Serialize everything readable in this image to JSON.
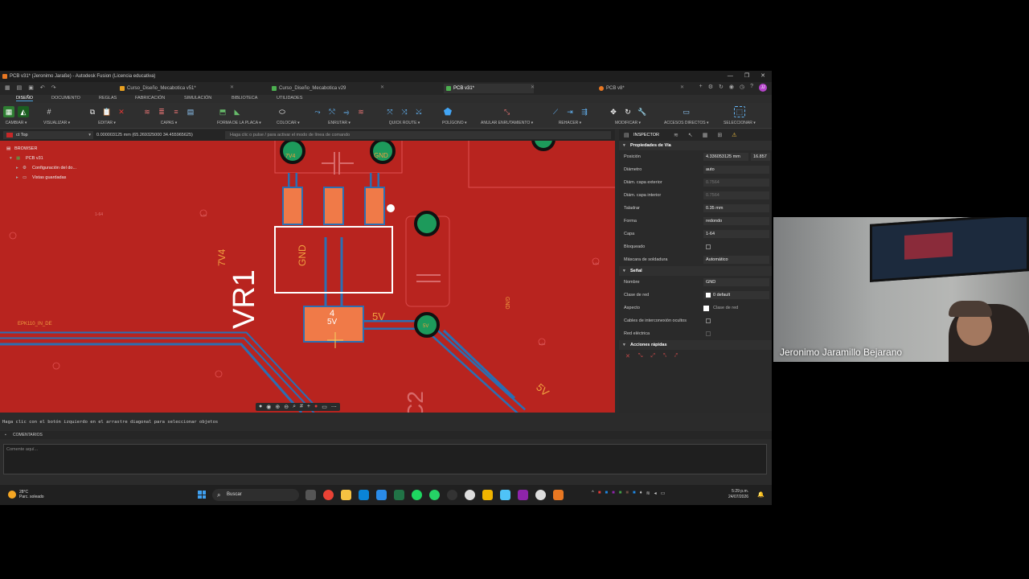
{
  "window": {
    "title": "PCB v31* (Jeronimo Jaraße) - Autodesk Fusion (Licencia educativa)"
  },
  "tabs": [
    {
      "label": "Curso_Diseño_Mecabotica v51*",
      "color": "#e8a020"
    },
    {
      "label": "Curso_Diseño_Mecabotica v29",
      "color": "#4caf50"
    },
    {
      "label": "PCB v31*",
      "color": "#4caf50"
    },
    {
      "label": "PCB v8*",
      "color": "#e87722"
    }
  ],
  "badge": "JJ",
  "ribbon_tabs": [
    "DISEÑO",
    "DOCUMENTO",
    "REGLAS",
    "FABRICACIÓN",
    "SIMULACIÓN",
    "BIBLIOTECA",
    "UTILIDADES"
  ],
  "ribbon_groups": [
    {
      "label": "CAMBIAR ▾"
    },
    {
      "label": "VISUALIZAR ▾"
    },
    {
      "label": "EDITAR ▾"
    },
    {
      "label": "CAPAS ▾"
    },
    {
      "label": "FORMA DE LA PLACA ▾"
    },
    {
      "label": "COLOCAR ▾"
    },
    {
      "label": "ENRUTAR ▾"
    },
    {
      "label": "QUICK ROUTE ▾"
    },
    {
      "label": "POLÍGONO ▾"
    },
    {
      "label": "ANULAR ENRUTAMIENTO ▾"
    },
    {
      "label": "REHACER ▾"
    },
    {
      "label": "MODIFICAR ▾"
    },
    {
      "label": "ACCESOS DIRECTOS ▾"
    },
    {
      "label": "SELECCIONAR ▾"
    }
  ],
  "layer": "ct Top",
  "coords": "0.000003125 mm (65.269325000 34.455965625)",
  "command_placeholder": "Haga clic o pulse / para activar el modo de línea de comando",
  "browser": {
    "header": "BROWSER",
    "root": "PCB v31",
    "items": [
      "Configuración del do...",
      "Vistas guardadas"
    ]
  },
  "canvas_labels": {
    "vr1": "VR1",
    "c2": "C2",
    "net_5v_a": "5V",
    "net_5v_b": "5V",
    "net_7v4": "7V4",
    "net_gnd": "GND",
    "net_epk": "EPK110_IN_DE",
    "pad_4": "4",
    "pad_5v": "5V",
    "via_7v4": "7V4",
    "via_gnd": "GND",
    "via_gnd2": "GND",
    "via_5v": "5V",
    "layer_tag": "1-64"
  },
  "inspector": {
    "tab": "INSPECTOR",
    "section_via": "Propiedades de Vía",
    "rows": [
      {
        "k": "Posición",
        "v": "4.336053125 mm",
        "v2": "16.857"
      },
      {
        "k": "Diámetro",
        "v": "auto"
      },
      {
        "k": "Diám. capa exterior",
        "v": "0.7564",
        "dim": true
      },
      {
        "k": "Diám. capa interior",
        "v": "0.7564",
        "dim": true
      },
      {
        "k": "Taladrar",
        "v": "0.35 mm"
      },
      {
        "k": "Forma",
        "v": "redondo"
      },
      {
        "k": "Capa",
        "v": "1-64"
      },
      {
        "k": "Bloqueado",
        "v": ""
      },
      {
        "k": "Máscara de soldadura",
        "v": "Automático"
      }
    ],
    "section_signal": "Señal",
    "signal_rows": [
      {
        "k": "Nombre",
        "v": "GND"
      },
      {
        "k": "Clase de red",
        "v": "0 default"
      },
      {
        "k": "Aspecto",
        "v": "Clase de red"
      },
      {
        "k": "Cables de interconexión ocultos",
        "v": ""
      },
      {
        "k": "Red eléctrica",
        "v": ""
      }
    ],
    "section_actions": "Acciones rápidas"
  },
  "status_text": "Haga clic con el botón izquierdo en el arrastre diagonal para seleccionar objetos",
  "comments": {
    "header": "COMENTARIOS",
    "placeholder": "Comente aquí..."
  },
  "taskbar": {
    "temp": "28°C",
    "weather": "Parc. soleado",
    "search": "Buscar",
    "time": "5:29 p.m.",
    "date": "24/07/2026"
  },
  "webcam": {
    "name": "Jeronimo Jaramillo Bejarano"
  }
}
